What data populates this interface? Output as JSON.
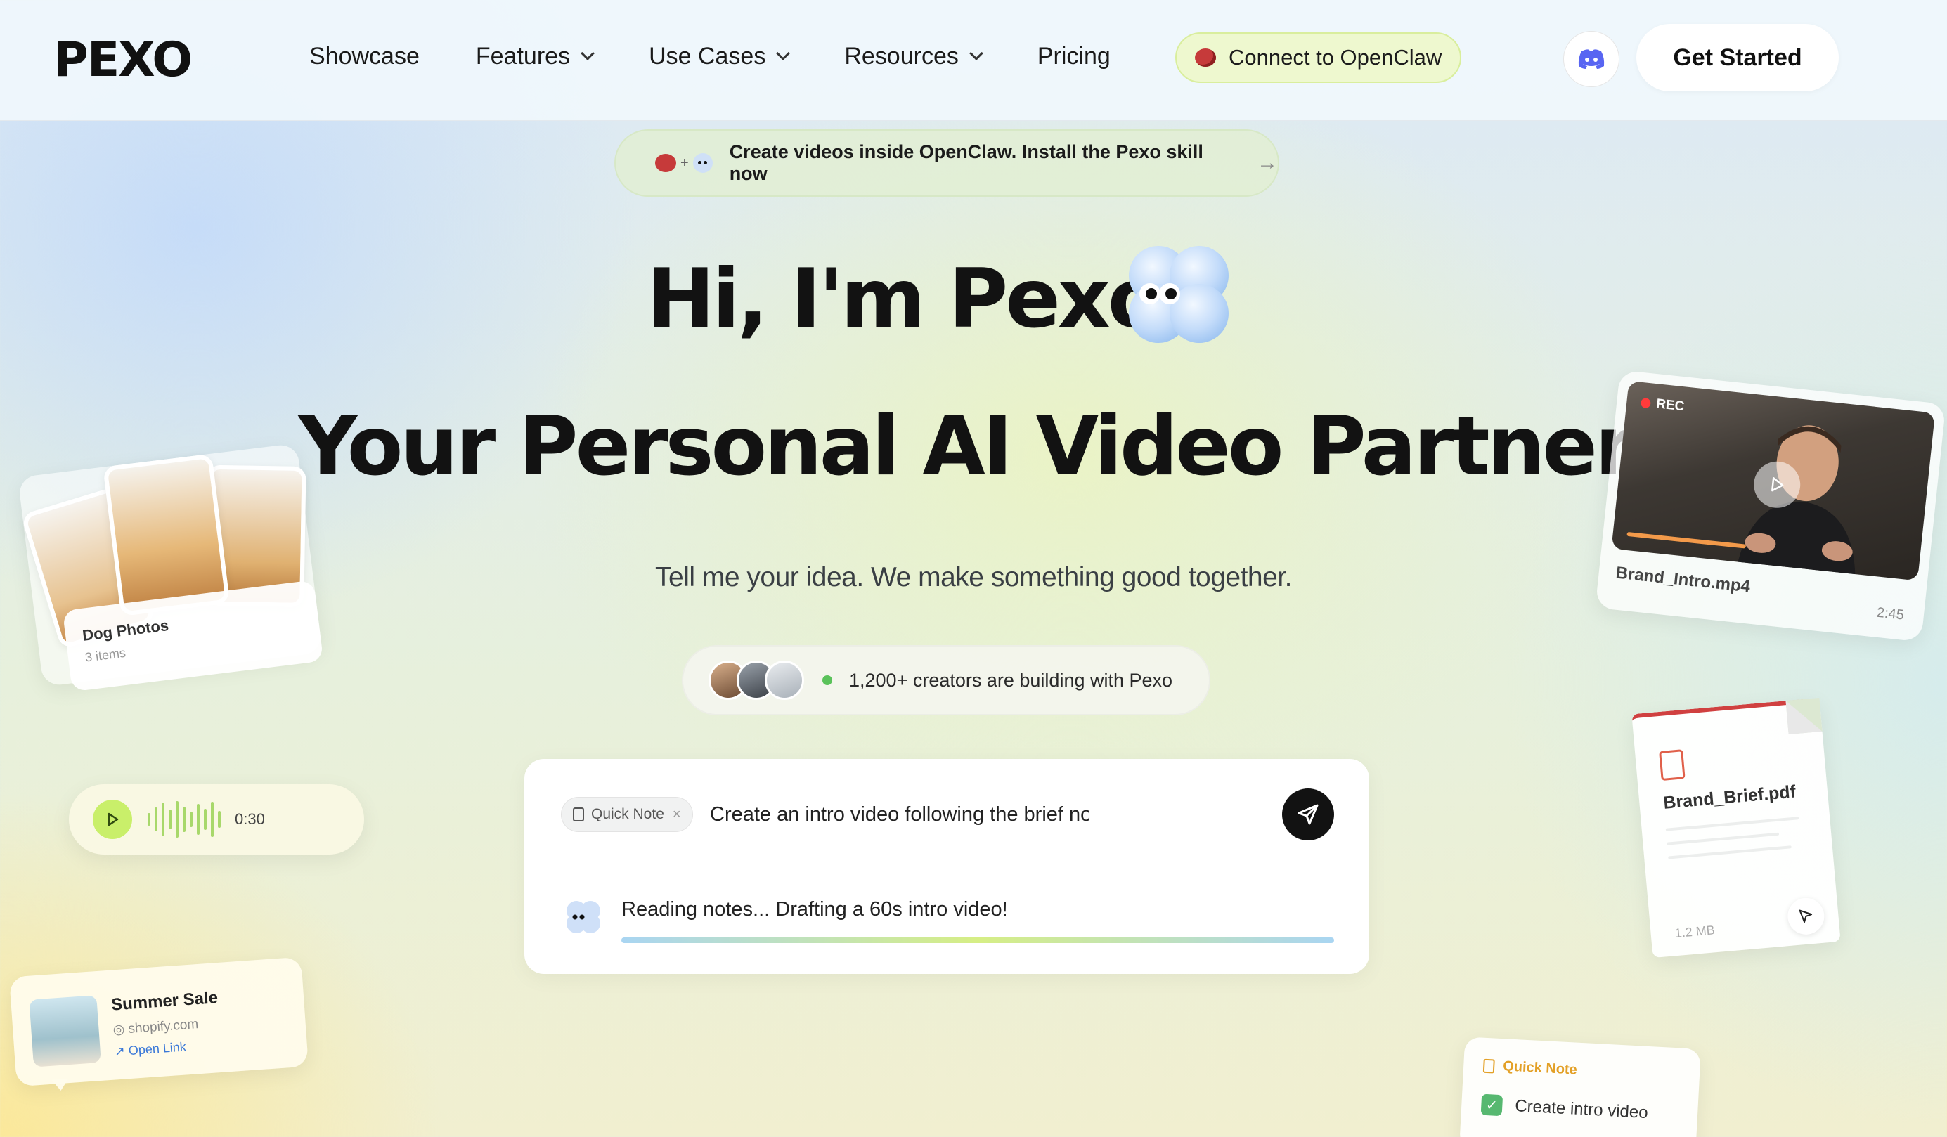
{
  "brand": {
    "logo": "PEXO"
  },
  "nav": {
    "items": [
      {
        "label": "Showcase",
        "dropdown": false
      },
      {
        "label": "Features",
        "dropdown": true
      },
      {
        "label": "Use Cases",
        "dropdown": true
      },
      {
        "label": "Resources",
        "dropdown": true
      },
      {
        "label": "Pricing",
        "dropdown": false
      }
    ],
    "openclaw_label": "Connect to OpenClaw",
    "discord_icon": "discord-icon",
    "get_started_label": "Get Started"
  },
  "banner": {
    "text": "Create videos inside OpenClaw. Install the Pexo skill now",
    "plus": "+",
    "arrow": "→"
  },
  "hero": {
    "greeting": "Hi, I'm Pexo",
    "title": "Your Personal AI Video Partner.",
    "subtitle": "Tell me your idea. We make something good together."
  },
  "creators": {
    "text": "1,200+ creators are building with Pexo"
  },
  "prompt": {
    "chip_label": "Quick Note",
    "chip_close": "×",
    "input_value": "Create an intro video following the brief notes — keep it und",
    "status_text": "Reading notes... Drafting a 60s intro video!",
    "progress": 1.0
  },
  "floating": {
    "dog_photos": {
      "title": "Dog Photos",
      "subtitle": "3 items"
    },
    "audio": {
      "time": "0:30"
    },
    "sale": {
      "title": "Summer Sale",
      "domain": "shopify.com",
      "link": "Open Link"
    },
    "video": {
      "rec": "REC",
      "filename": "Brand_Intro.mp4",
      "duration": "2:45"
    },
    "pdf": {
      "filename": "Brand_Brief.pdf",
      "size": "1.2 MB"
    },
    "note": {
      "title": "Quick Note",
      "item": "Create intro video",
      "check": "✓"
    }
  },
  "colors": {
    "accent_green": "#c9ef6a",
    "openclaw_bg": "#eef8cf",
    "discord": "#5865f2",
    "rec_red": "#ff3b3b",
    "pdf_red": "#d04040",
    "note_orange": "#e3a026"
  }
}
